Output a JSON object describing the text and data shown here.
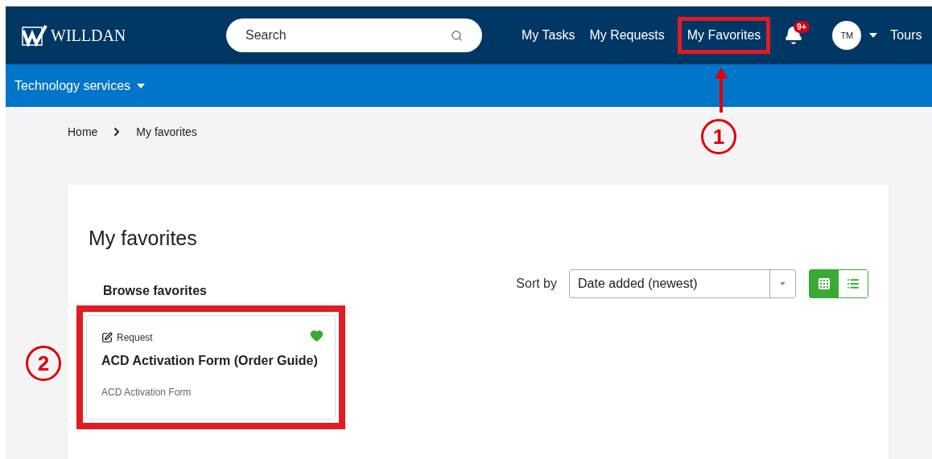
{
  "header": {
    "logo": "WILLDAN",
    "search": {
      "placeholder": "Search"
    },
    "nav": [
      {
        "label": "My Tasks",
        "selected": false
      },
      {
        "label": "My Requests",
        "selected": false
      },
      {
        "label": "My Favorites",
        "selected": true
      }
    ],
    "notifications": {
      "badge": "9+"
    },
    "avatar": "TM",
    "tours": "Tours"
  },
  "subnav": {
    "label": "Technology services"
  },
  "breadcrumb": [
    "Home",
    "My favorites"
  ],
  "page": {
    "title": "My favorites",
    "section": "Browse favorites",
    "sort": {
      "label": "Sort by",
      "value": "Date added (newest)"
    },
    "views": [
      {
        "kind": "grid",
        "selected": true
      },
      {
        "kind": "list",
        "selected": false
      }
    ],
    "cards": [
      {
        "type": "Request",
        "title": "ACD Activation Form (Order Guide)",
        "subtitle": "ACD Activation Form",
        "favorite": true
      }
    ]
  },
  "annotations": [
    {
      "label": "1"
    },
    {
      "label": "2"
    }
  ]
}
